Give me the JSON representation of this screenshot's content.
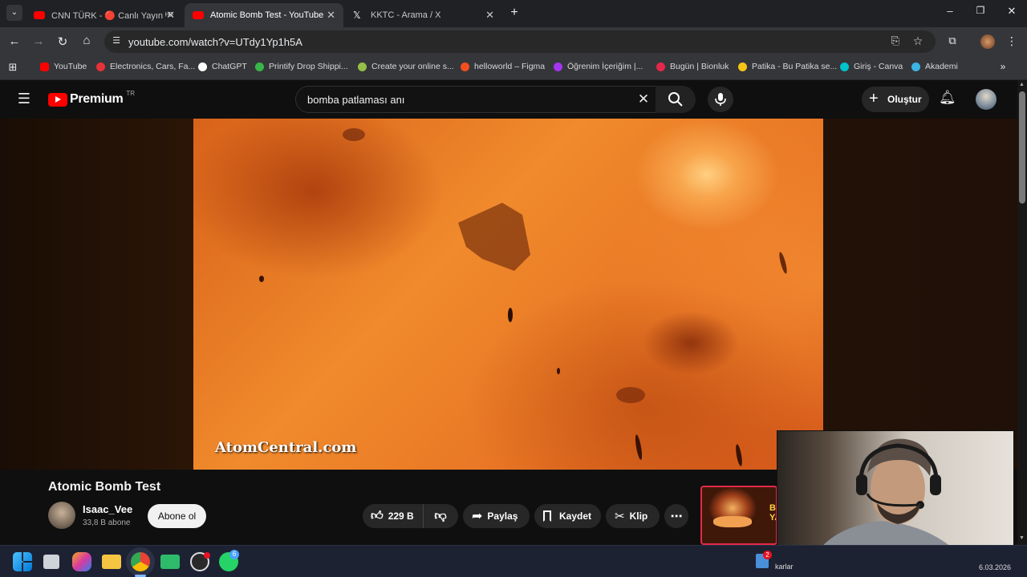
{
  "browser": {
    "tabs": [
      {
        "label": "CNN TÜRK - 🔴 Canlı Yayın ᴴᴰ",
        "favicon_color": "#ff0000"
      },
      {
        "label": "Atomic Bomb Test - YouTube",
        "favicon_color": "#ff0000",
        "active": true
      },
      {
        "label": "KKTC - Arama / X",
        "favicon_color": "#000000"
      }
    ],
    "url": "youtube.com/watch?v=UTdy1Yp1h5A",
    "bookmarks": [
      {
        "label": "YouTube",
        "color": "#ff0000"
      },
      {
        "label": "Electronics, Cars, Fa...",
        "color": "#e53238"
      },
      {
        "label": "ChatGPT",
        "color": "#ffffff"
      },
      {
        "label": "Printify Drop Shippi...",
        "color": "#39b54a"
      },
      {
        "label": "Create your online s...",
        "color": "#95bf47"
      },
      {
        "label": "helloworld – Figma",
        "color": "#f24e1e"
      },
      {
        "label": "Öğrenim İçeriğim |...",
        "color": "#a435f0"
      },
      {
        "label": "Bugün | Bionluk",
        "color": "#e4284a"
      },
      {
        "label": "Patika - Bu Patika se...",
        "color": "#f5c518"
      },
      {
        "label": "Giriş - Canva",
        "color": "#00c4cc"
      },
      {
        "label": "Akademi",
        "color": "#3cb4e5"
      }
    ]
  },
  "youtube": {
    "logo_label": "Premium",
    "region": "TR",
    "search_value": "bomba patlaması anı",
    "create_label": "Oluştur"
  },
  "video": {
    "watermark": "AtomCentral.com",
    "title": "Atomic Bomb Test",
    "channel_name": "Isaac_Vee",
    "subscribers": "33,8 B abone",
    "subscribe_label": "Abone ol",
    "likes": "229 B",
    "share_label": "Paylaş",
    "save_label": "Kaydet",
    "clip_label": "Klip"
  },
  "recommended": {
    "thumb_text": "BO YA"
  },
  "taskbar": {
    "weather_label": "karlar",
    "notification_count": "2",
    "whatsapp_count": "6",
    "date": "6.03.2026"
  }
}
